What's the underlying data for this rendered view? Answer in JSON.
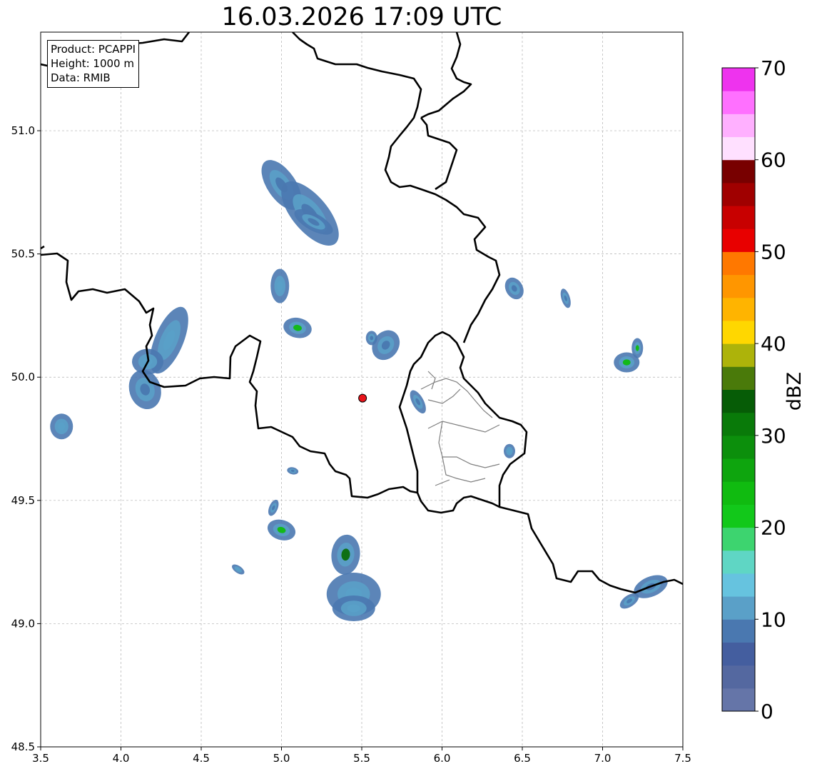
{
  "title": "16.03.2026 17:09 UTC",
  "info": {
    "product": "Product: PCAPPI",
    "height": "Height: 1000 m",
    "data": "Data: RMIB"
  },
  "map": {
    "lon_range": [
      3.5,
      7.5
    ],
    "lat_range": [
      48.5,
      51.4
    ],
    "x_ticks": [
      "3.5",
      "4.0",
      "4.5",
      "5.0",
      "5.5",
      "6.0",
      "6.5",
      "7.0",
      "7.5"
    ],
    "y_ticks": [
      "48.5",
      "49.0",
      "49.5",
      "50.0",
      "50.5",
      "51.0"
    ],
    "x_tick_values": [
      3.5,
      4.0,
      4.5,
      5.0,
      5.5,
      6.0,
      6.5,
      7.0,
      7.5
    ],
    "y_tick_values": [
      48.5,
      49.0,
      49.5,
      50.0,
      50.5,
      51.0
    ],
    "grid": true,
    "radar_site": {
      "lon": 5.505,
      "lat": 49.915,
      "color": "#e8141b"
    },
    "border_color": "#000000",
    "province_color": "#808080",
    "echoes": [
      {
        "lon": 5.0,
        "lat": 50.78,
        "color": "#4a78b0"
      },
      {
        "lon": 5.2,
        "lat": 50.63,
        "color": "#4a78b0"
      },
      {
        "lon": 4.99,
        "lat": 50.37,
        "color": "#5aa0c8"
      },
      {
        "lon": 5.1,
        "lat": 50.2,
        "color": "#10bb10"
      },
      {
        "lon": 5.65,
        "lat": 50.13,
        "color": "#4a78b0"
      },
      {
        "lon": 4.3,
        "lat": 50.15,
        "color": "#5aa0c8"
      },
      {
        "lon": 4.15,
        "lat": 49.95,
        "color": "#4a78b0"
      },
      {
        "lon": 3.63,
        "lat": 49.8,
        "color": "#5aa0c8"
      },
      {
        "lon": 6.45,
        "lat": 50.36,
        "color": "#4a78b0"
      },
      {
        "lon": 6.77,
        "lat": 50.32,
        "color": "#4a78b0"
      },
      {
        "lon": 7.15,
        "lat": 50.06,
        "color": "#10bb10"
      },
      {
        "lon": 5.85,
        "lat": 49.9,
        "color": "#4a78b0"
      },
      {
        "lon": 6.42,
        "lat": 49.7,
        "color": "#5aa0c8"
      },
      {
        "lon": 4.95,
        "lat": 49.47,
        "color": "#4a78b0"
      },
      {
        "lon": 5.0,
        "lat": 49.38,
        "color": "#10bb10"
      },
      {
        "lon": 5.4,
        "lat": 49.28,
        "color": "#0b6e0b"
      },
      {
        "lon": 5.45,
        "lat": 49.12,
        "color": "#5aa0c8"
      },
      {
        "lon": 4.73,
        "lat": 49.22,
        "color": "#5aa0c8"
      },
      {
        "lon": 5.07,
        "lat": 49.62,
        "color": "#4a78b0"
      },
      {
        "lon": 7.3,
        "lat": 49.15,
        "color": "#4a78b0"
      }
    ]
  },
  "colorbar": {
    "label": "dBZ",
    "range": [
      0,
      70
    ],
    "tick_values": [
      0,
      10,
      20,
      30,
      40,
      50,
      60,
      70
    ],
    "tick_labels": [
      "0",
      "10",
      "20",
      "30",
      "40",
      "50",
      "60",
      "70"
    ],
    "colors": [
      "#6575a8",
      "#5468a0",
      "#445e9f",
      "#4a78b0",
      "#5aa0c8",
      "#66c3df",
      "#5fd6c4",
      "#3dd46f",
      "#12c81a",
      "#10bb10",
      "#0ea50e",
      "#0c8f0c",
      "#097a09",
      "#065c06",
      "#4a7a0a",
      "#adb30a",
      "#ffd700",
      "#ffb400",
      "#ff9600",
      "#ff7800",
      "#e80000",
      "#c80000",
      "#a00000",
      "#780000",
      "#ffe0ff",
      "#ffb0ff",
      "#ff70ff",
      "#ee33ee"
    ]
  }
}
